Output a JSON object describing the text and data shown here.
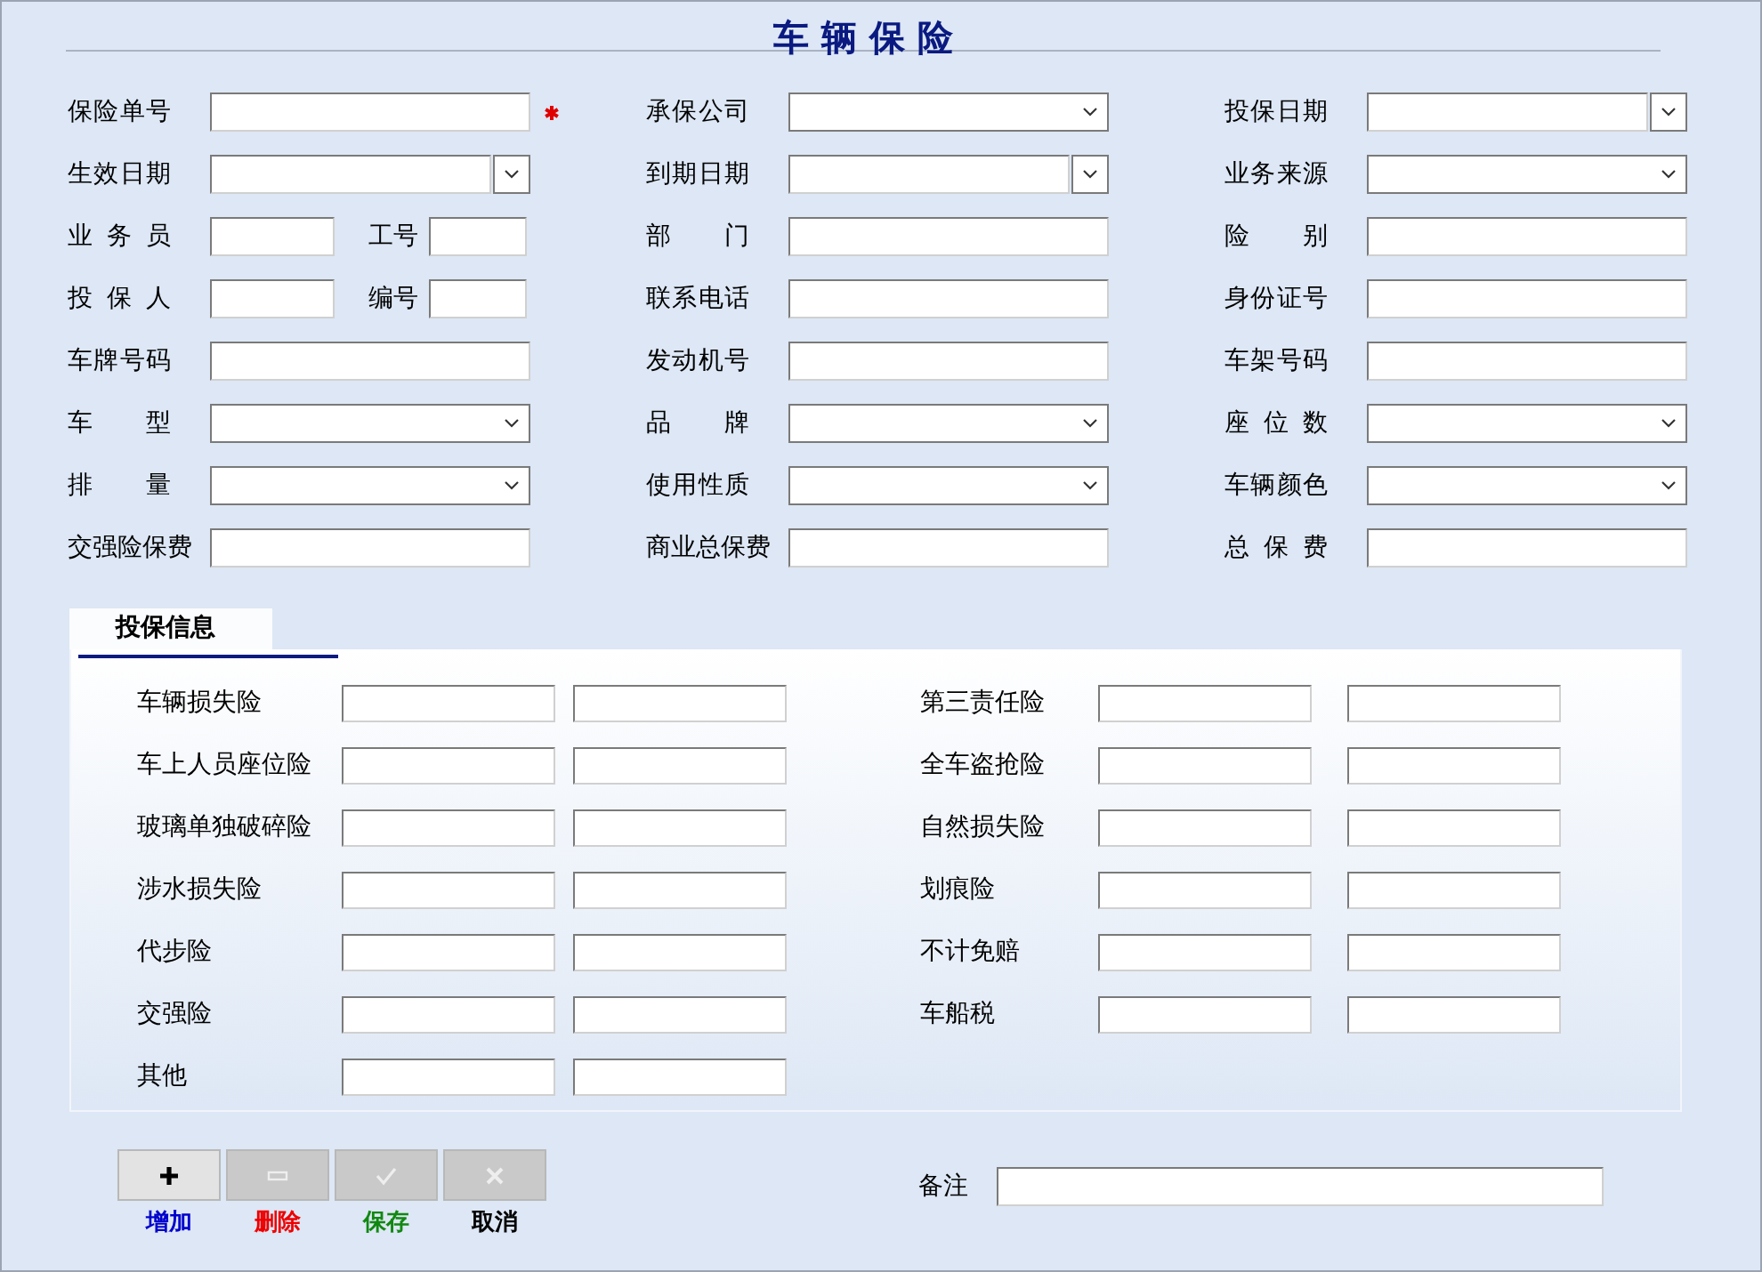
{
  "title": "车 辆 保 险",
  "fields": [
    {
      "label": "保险单号",
      "kind": "text",
      "required": true
    },
    {
      "label": "承保公司",
      "kind": "select",
      "required": false
    },
    {
      "label": "投保日期",
      "kind": "date",
      "required": false
    },
    {
      "label": "生效日期",
      "kind": "date",
      "required": false
    },
    {
      "label": "到期日期",
      "kind": "date",
      "required": false
    },
    {
      "label": "业务来源",
      "kind": "select",
      "required": false
    },
    {
      "label": "业 务 员",
      "kind": "split",
      "sub_label": "工号",
      "required": false
    },
    {
      "label": "部 门",
      "kind": "text",
      "required": false
    },
    {
      "label": "险 别",
      "kind": "text",
      "required": false
    },
    {
      "label": "投 保 人",
      "kind": "split",
      "sub_label": "编号",
      "required": false
    },
    {
      "label": "联系电话",
      "kind": "text",
      "required": false
    },
    {
      "label": "身份证号",
      "kind": "text",
      "required": false
    },
    {
      "label": "车牌号码",
      "kind": "text",
      "required": false
    },
    {
      "label": "发动机号",
      "kind": "text",
      "required": false
    },
    {
      "label": "车架号码",
      "kind": "text",
      "required": false
    },
    {
      "label": "车 型",
      "kind": "select",
      "required": false
    },
    {
      "label": "品 牌",
      "kind": "select",
      "required": false
    },
    {
      "label": "座 位 数",
      "kind": "select",
      "required": false
    },
    {
      "label": "排 量",
      "kind": "select",
      "required": false
    },
    {
      "label": "使用性质",
      "kind": "select",
      "required": false
    },
    {
      "label": "车辆颜色",
      "kind": "select",
      "required": false
    },
    {
      "label": "交强险保费",
      "kind": "text",
      "required": false
    },
    {
      "label": "商业总保费",
      "kind": "text",
      "required": false
    },
    {
      "label": "总 保 费",
      "kind": "text",
      "required": false
    }
  ],
  "tabs": [
    {
      "label": "投保信息",
      "selected": true
    }
  ],
  "coverages_left": [
    {
      "label": "车辆损失险"
    },
    {
      "label": "车上人员座位险"
    },
    {
      "label": "玻璃单独破碎险"
    },
    {
      "label": "涉水损失险"
    },
    {
      "label": "代步险"
    },
    {
      "label": "交强险"
    },
    {
      "label": "其他"
    }
  ],
  "coverages_right": [
    {
      "label": "第三责任险"
    },
    {
      "label": "全车盗抢险"
    },
    {
      "label": "自然损失险"
    },
    {
      "label": "划痕险"
    },
    {
      "label": "不计免赔"
    },
    {
      "label": "车船税"
    }
  ],
  "buttons": [
    {
      "kind": "add",
      "label": "增加",
      "disabled": false,
      "color": "#0000cc"
    },
    {
      "kind": "delete",
      "label": "删除",
      "disabled": true,
      "color": "#ee0000"
    },
    {
      "kind": "save",
      "label": "保存",
      "disabled": true,
      "color": "#118811"
    },
    {
      "kind": "cancel",
      "label": "取消",
      "disabled": true,
      "color": "#000000"
    }
  ],
  "remark": {
    "label": "备注"
  }
}
